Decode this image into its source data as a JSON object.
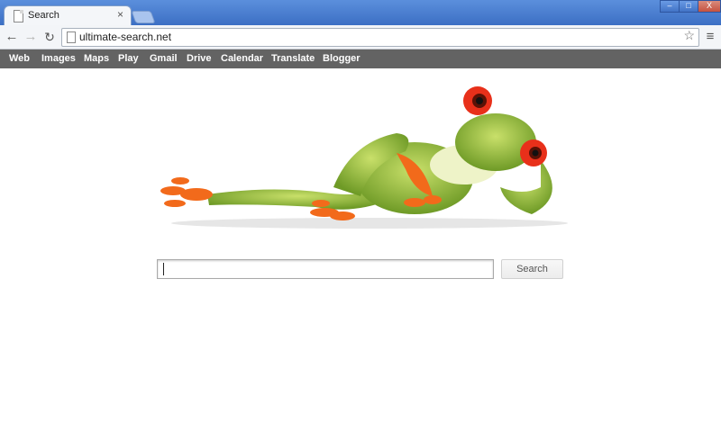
{
  "browser": {
    "tab_title": "Search",
    "tab_close": "×",
    "url": "ultimate-search.net",
    "window_controls": {
      "minimize": "–",
      "maximize": "□",
      "close": "X"
    }
  },
  "nav": {
    "back_icon": "←",
    "forward_icon": "→",
    "reload_icon": "↻",
    "star_icon": "☆",
    "menu_icon": "≡"
  },
  "appbar": {
    "items": [
      "Web",
      "Images",
      "Maps",
      "Play",
      "Gmail",
      "Drive",
      "Calendar",
      "Translate",
      "Blogger"
    ]
  },
  "search": {
    "input_value": "",
    "button_label": "Search"
  },
  "colors": {
    "titlebar": "#3c6fc4",
    "appbar": "#636363",
    "frog_green": "#8cbf3a",
    "frog_orange": "#f26a1b",
    "eye_red": "#e8301a"
  }
}
